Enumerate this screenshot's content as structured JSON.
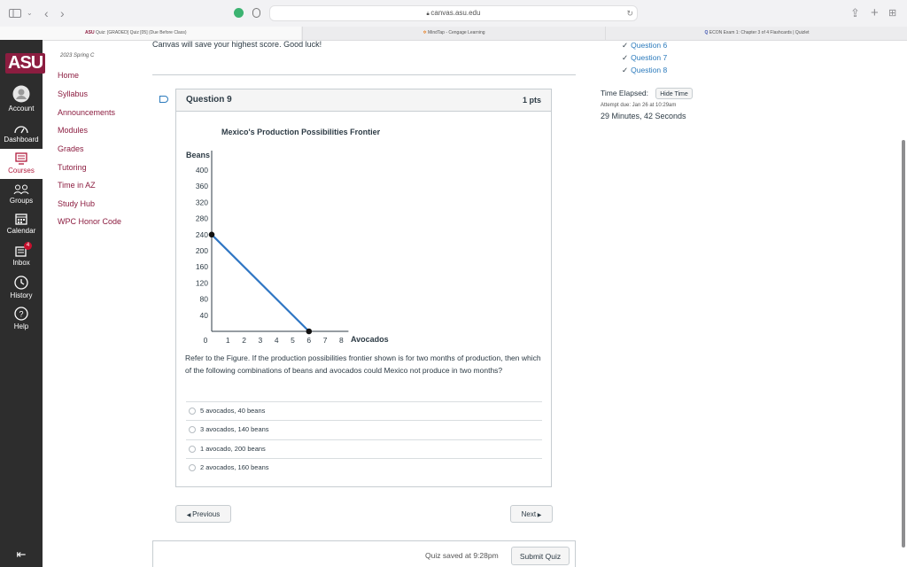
{
  "browser": {
    "address": "canvas.asu.edu",
    "tabs": [
      "Quiz: [GRADED] Quiz [05] (Due Before Class)",
      "MindTap - Cengage Learning",
      "ECON Exam 1: Chapter 3 of 4 Flashcards | Quizlet"
    ],
    "sidebar_toggle_icon": "sidebar-icon",
    "share_icon": "share-icon",
    "new_tab_icon": "plus-icon",
    "tab_overview_icon": "grid-icon"
  },
  "global_nav": {
    "logo": "ASU",
    "items": [
      {
        "label": "Account",
        "icon": "account-icon"
      },
      {
        "label": "Dashboard",
        "icon": "dashboard-icon"
      },
      {
        "label": "Courses",
        "icon": "courses-icon"
      },
      {
        "label": "Groups",
        "icon": "groups-icon"
      },
      {
        "label": "Calendar",
        "icon": "calendar-icon"
      },
      {
        "label": "Inbox",
        "icon": "inbox-icon",
        "badge": "4"
      },
      {
        "label": "History",
        "icon": "history-icon"
      },
      {
        "label": "Help",
        "icon": "help-icon"
      }
    ],
    "collapse_icon": "collapse-icon"
  },
  "course_nav": {
    "term": "2023 Spring C",
    "items": [
      "Home",
      "Syllabus",
      "Announcements",
      "Modules",
      "Grades",
      "Tutoring",
      "Time in AZ",
      "Study Hub",
      "WPC Honor Code"
    ]
  },
  "quiz": {
    "top_note": "Canvas will save your highest score. Good luck!",
    "question_title": "Question 9",
    "points": "1 pts",
    "chart_title": "Mexico's Production Possibilities Frontier",
    "question_text": "Refer to the Figure. If the production possibilities frontier shown is for two months of production, then which of the following combinations of beans and avocados could Mexico not produce in two months?",
    "answers": [
      "5 avocados, 40 beans",
      "3 avocados, 140 beans",
      "1 avocado, 200 beans",
      "2 avocados, 160 beans"
    ],
    "previous_label": "Previous",
    "next_label": "Next",
    "saved_text": "Quiz saved at 9:28pm",
    "submit_label": "Submit Quiz"
  },
  "chart_data": {
    "type": "line",
    "title": "Mexico's Production Possibilities Frontier",
    "xlabel": "Avocados",
    "ylabel": "Beans",
    "x_ticks": [
      "0",
      "1",
      "2",
      "3",
      "4",
      "5",
      "6",
      "7",
      "8"
    ],
    "y_ticks": [
      "40",
      "80",
      "120",
      "160",
      "200",
      "240",
      "280",
      "320",
      "360",
      "400"
    ],
    "xlim": [
      0,
      8
    ],
    "ylim": [
      0,
      400
    ],
    "series": [
      {
        "x": [
          0,
          6
        ],
        "y": [
          240,
          0
        ],
        "color": "#2e75c3"
      }
    ],
    "markers": [
      {
        "x": 0,
        "y": 240
      },
      {
        "x": 6,
        "y": 0
      }
    ]
  },
  "sidebar": {
    "questions": [
      "Question 6",
      "Question 7",
      "Question 8"
    ],
    "time_elapsed_label": "Time Elapsed:",
    "hide_time_label": "Hide Time",
    "attempt_due": "Attempt due: Jan 26 at 10:29am",
    "elapsed_value": "29 Minutes, 42 Seconds"
  },
  "colors": {
    "asu_maroon": "#8c1d40",
    "nav_dark": "#2d2d2d",
    "link_blue": "#2b7abc",
    "chart_line": "#2e75c3"
  }
}
